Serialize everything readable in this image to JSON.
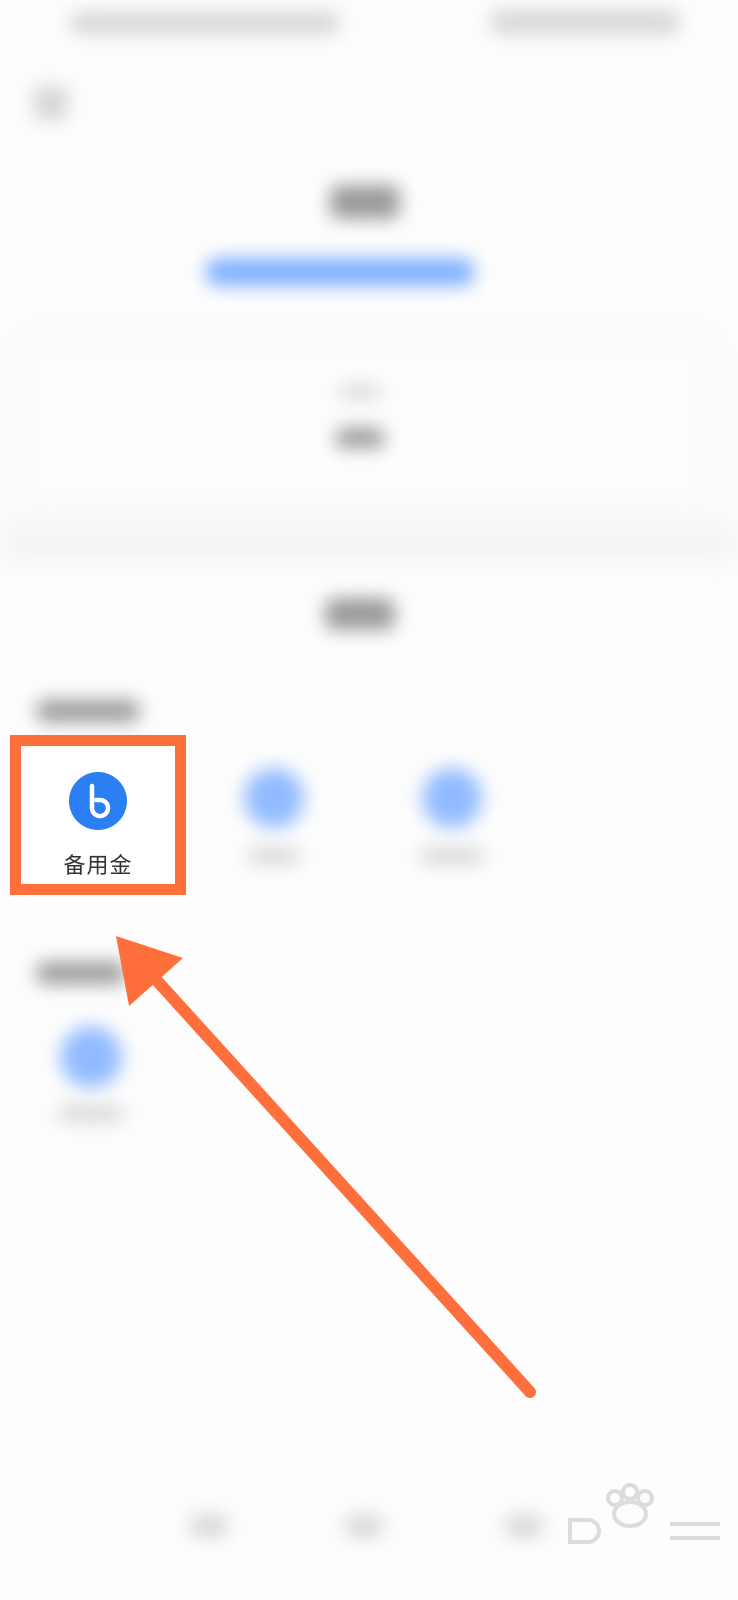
{
  "app_icon": {
    "label": "备用金",
    "icon": "b-logo-icon",
    "icon_color": "#2a7ff3",
    "highlight_color": "#ff6f3c"
  },
  "annotation": {
    "arrow_color": "#ff6f3c"
  }
}
